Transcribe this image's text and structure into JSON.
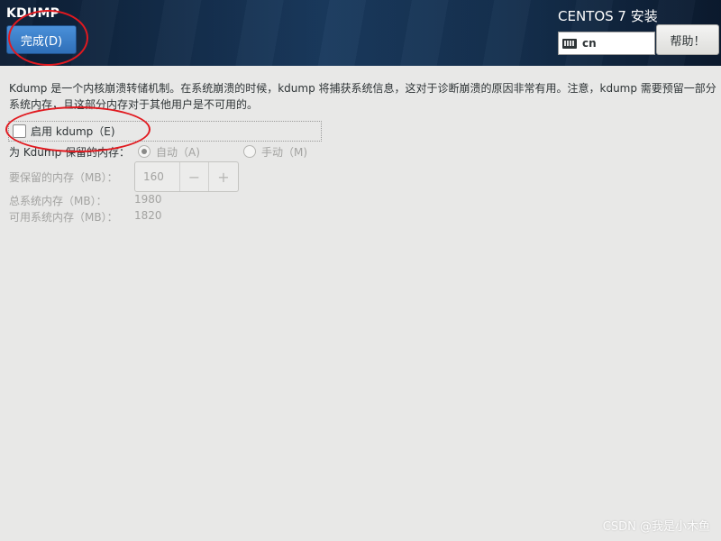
{
  "header": {
    "spoke_title": "KDUMP",
    "done_label": "完成(D)",
    "product_title": "CENTOS 7 安装",
    "keyboard_layout": "cn",
    "help_label": "帮助！"
  },
  "content": {
    "description": "Kdump 是一个内核崩溃转储机制。在系统崩溃的时候，kdump 将捕获系统信息，这对于诊断崩溃的原因非常有用。注意，kdump 需要预留一部分系统内存，且这部分内存对于其他用户是不可用的。",
    "enable_label": "启用 kdump（E)",
    "enable_checked": false,
    "reserve_label": "为 Kdump 保留的内存：",
    "reserve_options": [
      {
        "label": "自动（A)",
        "selected": true
      },
      {
        "label": "手动（M)",
        "selected": false
      }
    ],
    "memory_label": "要保留的内存（MB）：",
    "memory_value": "160",
    "decrement": "−",
    "increment": "+",
    "total_label": "总系统内存（MB）：",
    "total_value": "1980",
    "available_label": "可用系统内存（MB）：",
    "available_value": "1820"
  },
  "watermark": "CSDN @我是小木鱼",
  "colors": {
    "header_bg": "#15304f",
    "primary_button": "#3a80cc",
    "annotation_red": "#e1191f",
    "page_bg": "#e8e8e7"
  }
}
